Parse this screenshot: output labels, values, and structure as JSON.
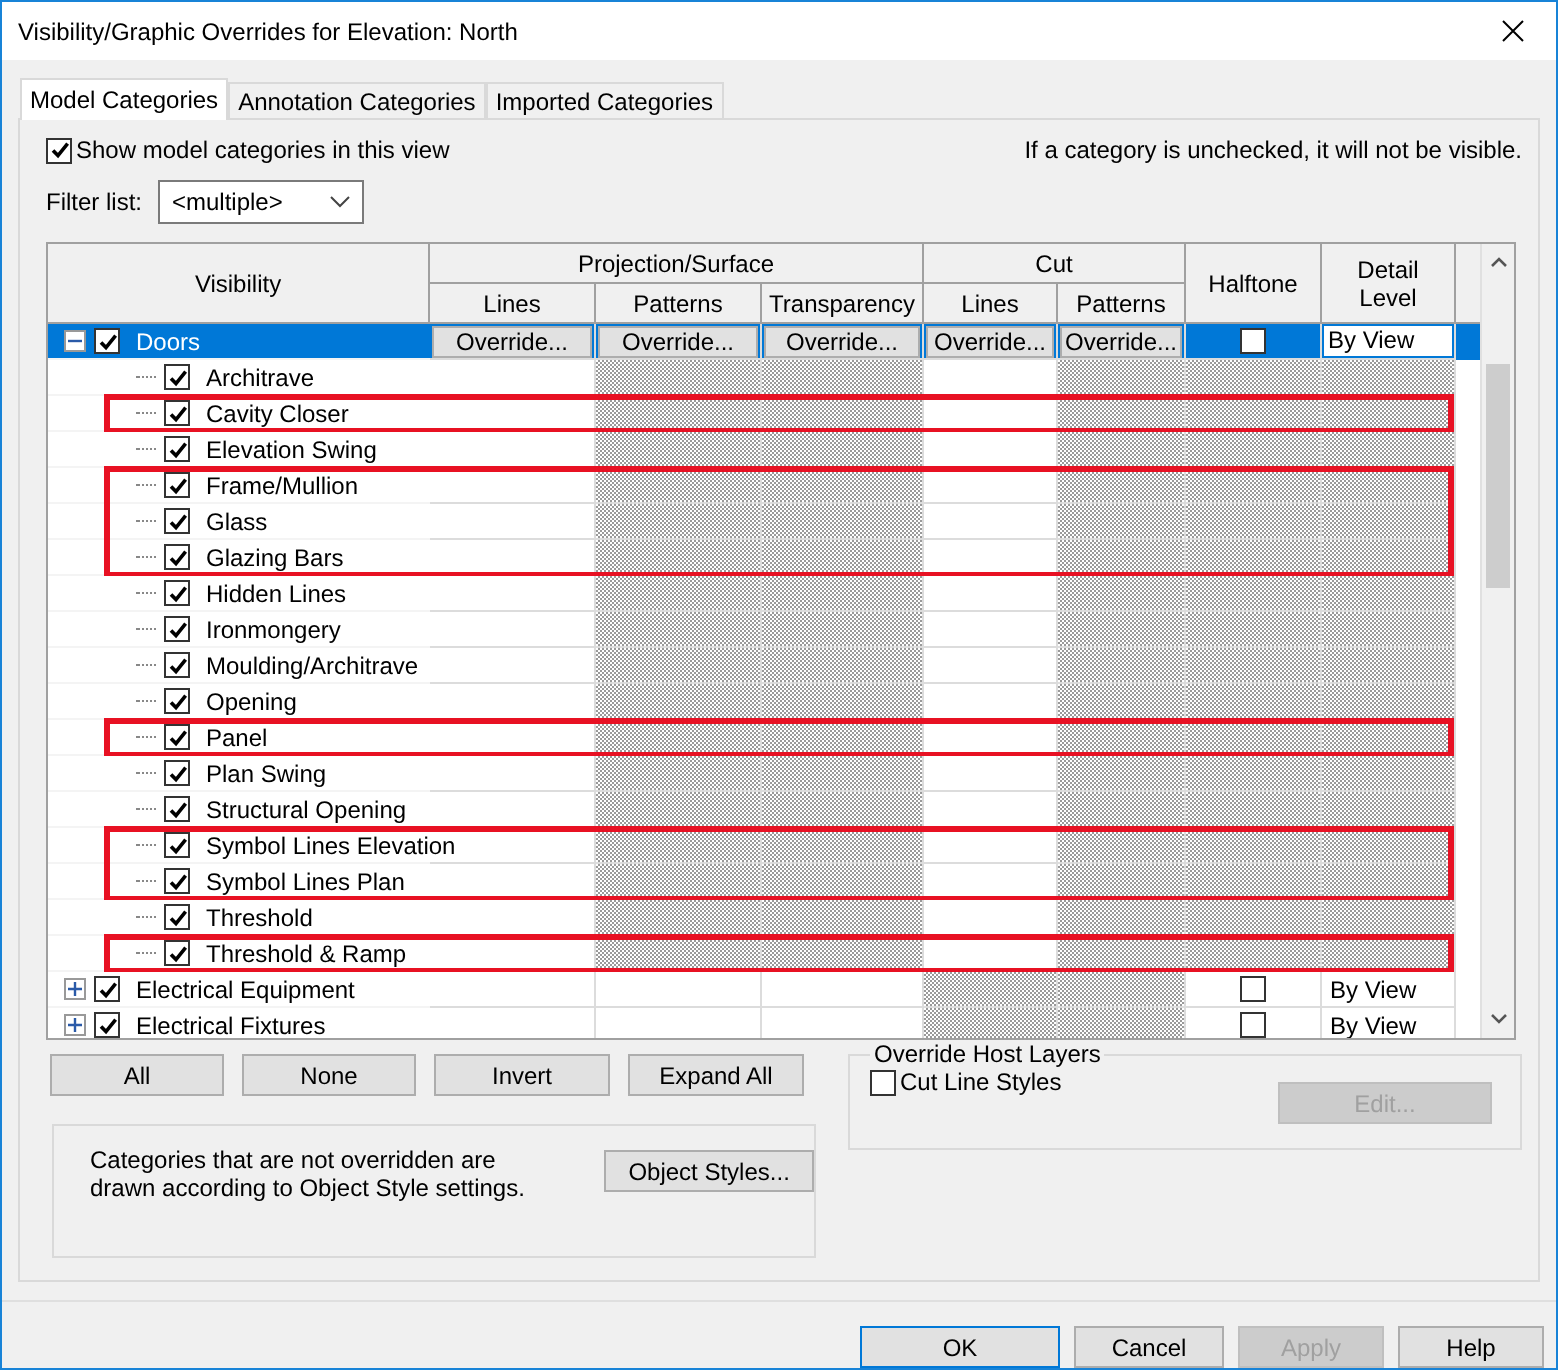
{
  "window": {
    "title": "Visibility/Graphic Overrides for Elevation: North"
  },
  "tabs": [
    {
      "label": "Model Categories",
      "selected": true
    },
    {
      "label": "Annotation Categories",
      "selected": false
    },
    {
      "label": "Imported Categories",
      "selected": false
    }
  ],
  "show_categories": {
    "label": "Show model categories in this view",
    "checked": true
  },
  "hint": "If a category is unchecked, it will not be visible.",
  "filter": {
    "label": "Filter list:",
    "value": "<multiple>"
  },
  "table": {
    "visibility_header": "Visibility",
    "groups": [
      {
        "label": "Projection/Surface",
        "columns": [
          "Lines",
          "Patterns",
          "Transparency"
        ]
      },
      {
        "label": "Cut",
        "columns": [
          "Lines",
          "Patterns"
        ]
      }
    ],
    "single_columns": [
      "Halftone",
      "Detail Level"
    ],
    "rows": [
      {
        "name": "Doors",
        "checked": true,
        "selected": true,
        "expanded": true,
        "highlighted": false,
        "cells": [
          {
            "kind": "override",
            "text": "Override..."
          },
          {
            "kind": "override",
            "text": "Override..."
          },
          {
            "kind": "override",
            "text": "Override..."
          },
          {
            "kind": "override",
            "text": "Override..."
          },
          {
            "kind": "override",
            "text": "Override..."
          },
          {
            "kind": "checkbox",
            "checked": false
          },
          {
            "kind": "field",
            "text": "By View"
          }
        ],
        "children": [
          {
            "name": "Architrave",
            "checked": true,
            "selected": false,
            "highlighted": false,
            "cells": [
              {
                "kind": "blank"
              },
              {
                "kind": "hatched"
              },
              {
                "kind": "hatched"
              },
              {
                "kind": "blank"
              },
              {
                "kind": "hatched"
              },
              {
                "kind": "hatched"
              },
              {
                "kind": "hatched"
              }
            ]
          },
          {
            "name": "Cavity Closer",
            "checked": true,
            "selected": false,
            "highlighted": true,
            "cells": [
              {
                "kind": "blank"
              },
              {
                "kind": "hatched"
              },
              {
                "kind": "hatched"
              },
              {
                "kind": "blank"
              },
              {
                "kind": "hatched"
              },
              {
                "kind": "hatched"
              },
              {
                "kind": "hatched"
              }
            ]
          },
          {
            "name": "Elevation Swing",
            "checked": true,
            "selected": false,
            "highlighted": false,
            "cells": [
              {
                "kind": "blank"
              },
              {
                "kind": "hatched"
              },
              {
                "kind": "hatched"
              },
              {
                "kind": "blank"
              },
              {
                "kind": "hatched"
              },
              {
                "kind": "hatched"
              },
              {
                "kind": "hatched"
              }
            ]
          },
          {
            "name": "Frame/Mullion",
            "checked": true,
            "selected": false,
            "highlighted": true,
            "cells": [
              {
                "kind": "blank"
              },
              {
                "kind": "hatched"
              },
              {
                "kind": "hatched"
              },
              {
                "kind": "blank"
              },
              {
                "kind": "hatched"
              },
              {
                "kind": "hatched"
              },
              {
                "kind": "hatched"
              }
            ]
          },
          {
            "name": "Glass",
            "checked": true,
            "selected": false,
            "highlighted": true,
            "cells": [
              {
                "kind": "blank"
              },
              {
                "kind": "hatched"
              },
              {
                "kind": "hatched"
              },
              {
                "kind": "blank"
              },
              {
                "kind": "hatched"
              },
              {
                "kind": "hatched"
              },
              {
                "kind": "hatched"
              }
            ]
          },
          {
            "name": "Glazing Bars",
            "checked": true,
            "selected": false,
            "highlighted": true,
            "cells": [
              {
                "kind": "blank"
              },
              {
                "kind": "hatched"
              },
              {
                "kind": "hatched"
              },
              {
                "kind": "blank"
              },
              {
                "kind": "hatched"
              },
              {
                "kind": "hatched"
              },
              {
                "kind": "hatched"
              }
            ]
          },
          {
            "name": "Hidden Lines",
            "checked": true,
            "selected": false,
            "highlighted": false,
            "cells": [
              {
                "kind": "blank"
              },
              {
                "kind": "hatched"
              },
              {
                "kind": "hatched"
              },
              {
                "kind": "blank"
              },
              {
                "kind": "hatched"
              },
              {
                "kind": "hatched"
              },
              {
                "kind": "hatched"
              }
            ]
          },
          {
            "name": "Ironmongery",
            "checked": true,
            "selected": false,
            "highlighted": false,
            "cells": [
              {
                "kind": "blank"
              },
              {
                "kind": "hatched"
              },
              {
                "kind": "hatched"
              },
              {
                "kind": "blank"
              },
              {
                "kind": "hatched"
              },
              {
                "kind": "hatched"
              },
              {
                "kind": "hatched"
              }
            ]
          },
          {
            "name": "Moulding/Architrave",
            "checked": true,
            "selected": false,
            "highlighted": false,
            "cells": [
              {
                "kind": "blank"
              },
              {
                "kind": "hatched"
              },
              {
                "kind": "hatched"
              },
              {
                "kind": "blank"
              },
              {
                "kind": "hatched"
              },
              {
                "kind": "hatched"
              },
              {
                "kind": "hatched"
              }
            ]
          },
          {
            "name": "Opening",
            "checked": true,
            "selected": false,
            "highlighted": false,
            "cells": [
              {
                "kind": "blank"
              },
              {
                "kind": "hatched"
              },
              {
                "kind": "hatched"
              },
              {
                "kind": "blank"
              },
              {
                "kind": "hatched"
              },
              {
                "kind": "hatched"
              },
              {
                "kind": "hatched"
              }
            ]
          },
          {
            "name": "Panel",
            "checked": true,
            "selected": false,
            "highlighted": true,
            "cells": [
              {
                "kind": "blank"
              },
              {
                "kind": "hatched"
              },
              {
                "kind": "hatched"
              },
              {
                "kind": "blank"
              },
              {
                "kind": "hatched"
              },
              {
                "kind": "hatched"
              },
              {
                "kind": "hatched"
              }
            ]
          },
          {
            "name": "Plan Swing",
            "checked": true,
            "selected": false,
            "highlighted": false,
            "cells": [
              {
                "kind": "blank"
              },
              {
                "kind": "hatched"
              },
              {
                "kind": "hatched"
              },
              {
                "kind": "blank"
              },
              {
                "kind": "hatched"
              },
              {
                "kind": "hatched"
              },
              {
                "kind": "hatched"
              }
            ]
          },
          {
            "name": "Structural Opening",
            "checked": true,
            "selected": false,
            "highlighted": false,
            "cells": [
              {
                "kind": "blank"
              },
              {
                "kind": "hatched"
              },
              {
                "kind": "hatched"
              },
              {
                "kind": "blank"
              },
              {
                "kind": "hatched"
              },
              {
                "kind": "hatched"
              },
              {
                "kind": "hatched"
              }
            ]
          },
          {
            "name": "Symbol Lines Elevation",
            "checked": true,
            "selected": false,
            "highlighted": true,
            "cells": [
              {
                "kind": "blank"
              },
              {
                "kind": "hatched"
              },
              {
                "kind": "hatched"
              },
              {
                "kind": "blank"
              },
              {
                "kind": "hatched"
              },
              {
                "kind": "hatched"
              },
              {
                "kind": "hatched"
              }
            ]
          },
          {
            "name": "Symbol Lines Plan",
            "checked": true,
            "selected": false,
            "highlighted": true,
            "cells": [
              {
                "kind": "blank"
              },
              {
                "kind": "hatched"
              },
              {
                "kind": "hatched"
              },
              {
                "kind": "blank"
              },
              {
                "kind": "hatched"
              },
              {
                "kind": "hatched"
              },
              {
                "kind": "hatched"
              }
            ]
          },
          {
            "name": "Threshold",
            "checked": true,
            "selected": false,
            "highlighted": false,
            "cells": [
              {
                "kind": "blank"
              },
              {
                "kind": "hatched"
              },
              {
                "kind": "hatched"
              },
              {
                "kind": "blank"
              },
              {
                "kind": "hatched"
              },
              {
                "kind": "hatched"
              },
              {
                "kind": "hatched"
              }
            ]
          },
          {
            "name": "Threshold & Ramp",
            "checked": true,
            "selected": false,
            "highlighted": true,
            "cells": [
              {
                "kind": "blank"
              },
              {
                "kind": "hatched"
              },
              {
                "kind": "hatched"
              },
              {
                "kind": "blank"
              },
              {
                "kind": "hatched"
              },
              {
                "kind": "hatched"
              },
              {
                "kind": "hatched"
              }
            ]
          }
        ]
      },
      {
        "name": "Electrical Equipment",
        "checked": true,
        "selected": false,
        "expanded": false,
        "highlighted": false,
        "cells": [
          {
            "kind": "blank"
          },
          {
            "kind": "blank"
          },
          {
            "kind": "blank"
          },
          {
            "kind": "hatched"
          },
          {
            "kind": "hatched"
          },
          {
            "kind": "checkbox",
            "checked": false
          },
          {
            "kind": "text",
            "text": "By View"
          }
        ]
      },
      {
        "name": "Electrical Fixtures",
        "checked": true,
        "selected": false,
        "expanded": false,
        "highlighted": false,
        "cells": [
          {
            "kind": "blank"
          },
          {
            "kind": "blank"
          },
          {
            "kind": "blank"
          },
          {
            "kind": "hatched"
          },
          {
            "kind": "hatched"
          },
          {
            "kind": "checkbox",
            "checked": false
          },
          {
            "kind": "text",
            "text": "By View"
          }
        ]
      }
    ]
  },
  "table_buttons": [
    "All",
    "None",
    "Invert",
    "Expand All"
  ],
  "info": {
    "text": "Categories that are not overridden are drawn according to Object Style settings.",
    "button": "Object Styles..."
  },
  "host_layers": {
    "title": "Override Host Layers",
    "checkbox": {
      "label": "Cut Line Styles",
      "checked": false
    },
    "button": {
      "label": "Edit...",
      "disabled": true
    }
  },
  "footer_buttons": [
    {
      "label": "OK",
      "default": true,
      "disabled": false
    },
    {
      "label": "Cancel",
      "default": false,
      "disabled": false
    },
    {
      "label": "Apply",
      "default": false,
      "disabled": true
    },
    {
      "label": "Help",
      "default": false,
      "disabled": false
    }
  ]
}
